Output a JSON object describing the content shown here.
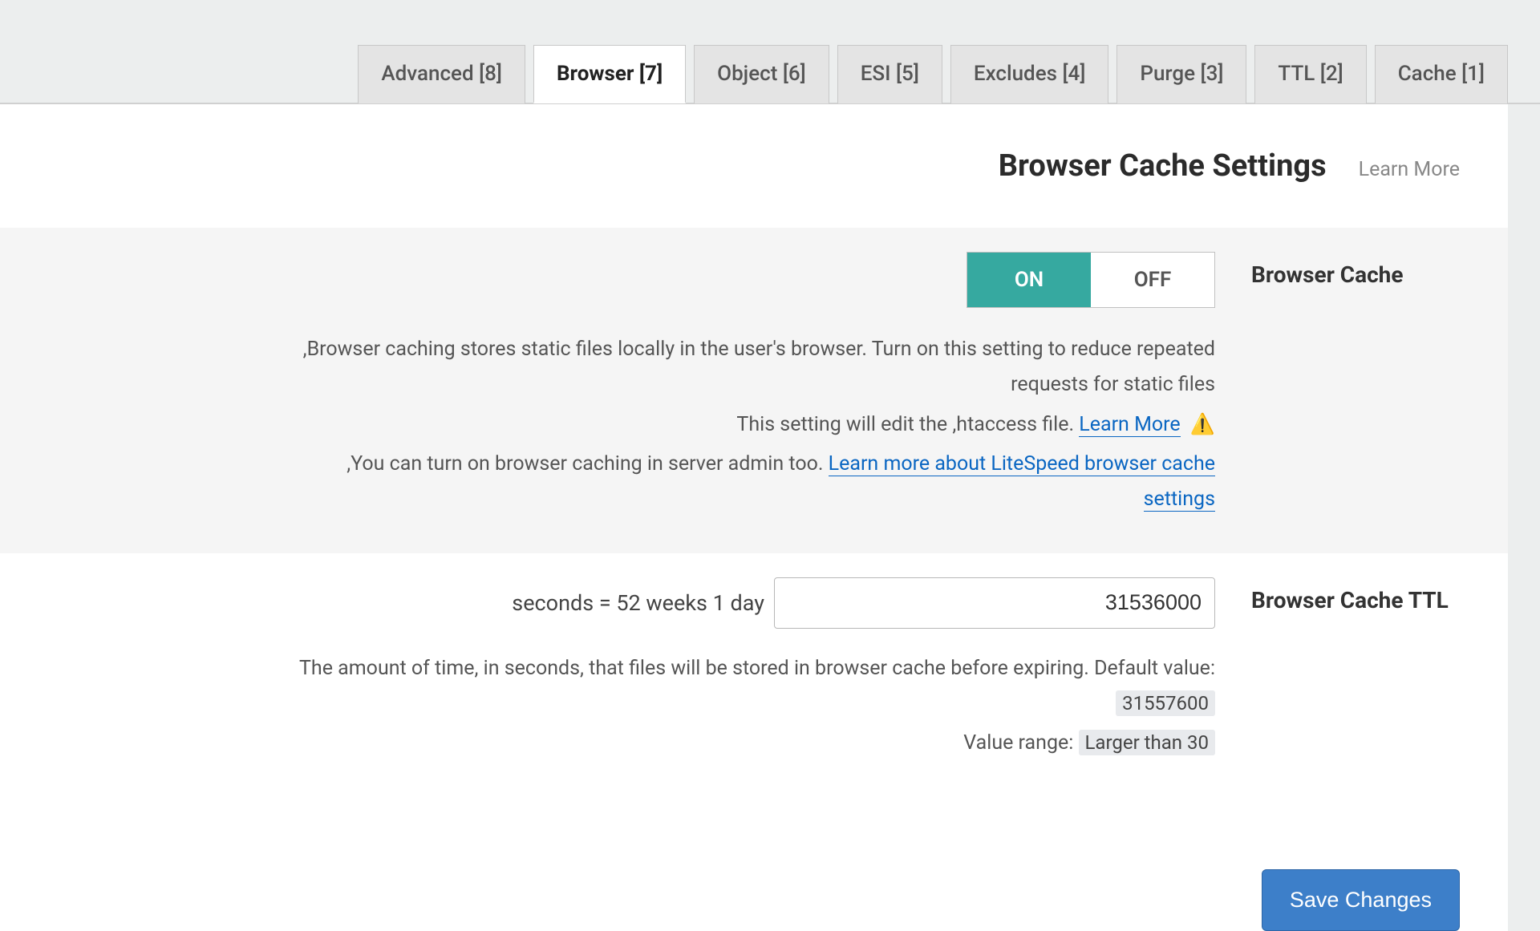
{
  "tabs": [
    {
      "label": "Advanced [8]"
    },
    {
      "label": "Browser [7]",
      "active": true
    },
    {
      "label": "Object [6]"
    },
    {
      "label": "ESI [5]"
    },
    {
      "label": "Excludes [4]"
    },
    {
      "label": "Purge [3]"
    },
    {
      "label": "TTL [2]"
    },
    {
      "label": "Cache [1]"
    }
  ],
  "header": {
    "title": "Browser Cache Settings",
    "learn_more": "Learn More"
  },
  "browser_cache": {
    "label": "Browser Cache",
    "toggle_on": "ON",
    "toggle_off": "OFF",
    "desc_main": ",Browser caching stores static files locally in the user's browser. Turn on this setting to reduce repeated requests for static files",
    "desc_htaccess_prefix": "This setting will edit the ,htaccess file. ",
    "desc_htaccess_link": "Learn More",
    "warn_icon": "⚠️",
    "desc_server_prefix": ",You can turn on browser caching in server admin too. ",
    "desc_server_link": "Learn more about LiteSpeed browser cache settings"
  },
  "ttl": {
    "label": "Browser Cache TTL",
    "hint": "seconds = 52 weeks 1 day",
    "value": "31536000",
    "desc_prefix": "The amount of time, in seconds, that files will be stored in browser cache before expiring. Default value: ",
    "default_value": "31557600",
    "range_prefix": "Value range: ",
    "range_value": "Larger than 30"
  },
  "footer": {
    "save": "Save Changes"
  }
}
